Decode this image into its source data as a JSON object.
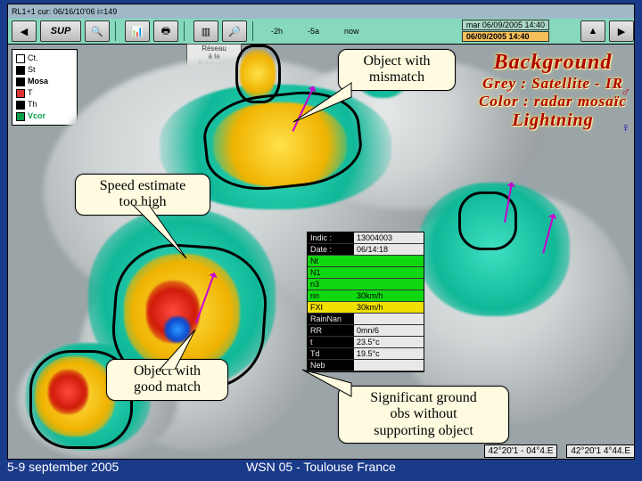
{
  "window_title": "RL1+1 cur: 06/16/10'06  i=149",
  "toolbar": {
    "sup_label": "SUP",
    "ticks": [
      "-2h",
      "-5a",
      "now"
    ],
    "date_valid": "mar 06/09/2005 14:40",
    "date_hilite": "06/09/2005 14:40"
  },
  "reseau": {
    "line1": "Réseau",
    "line2": "à la",
    "line3": "Echéance"
  },
  "left_legend": {
    "items": [
      {
        "label": "Ct.",
        "bold": false
      },
      {
        "label": "St",
        "bold": false
      },
      {
        "label": "Mosa",
        "bold": true
      },
      {
        "label": "T",
        "bold": false
      },
      {
        "label": "Th",
        "bold": false
      },
      {
        "label": "Vcor",
        "bold": true,
        "color": "#0aa04a"
      }
    ]
  },
  "bgtitle": {
    "l1": "Background",
    "l2": "Grey : Satellite - IR",
    "l3": "Color : radar mosaïc",
    "l4": "Lightning"
  },
  "callouts": {
    "mismatch": "Object with\nmismatch",
    "speed": "Speed estimate\ntoo high",
    "good": "Object with\ngood match",
    "ground": "Significant ground\nobs without\nsupporting object"
  },
  "infopanel": {
    "rows": [
      {
        "lab": "Indic :",
        "val": "13004003",
        "labcls": "",
        "valcls": ""
      },
      {
        "lab": "Date :",
        "val": "06/14:18",
        "labcls": "",
        "valcls": ""
      },
      {
        "lab": "Nt",
        "val": "",
        "labcls": "grn",
        "valcls": "grn"
      },
      {
        "lab": "N1",
        "val": "",
        "labcls": "grn",
        "valcls": "grn"
      },
      {
        "lab": "n3",
        "val": "",
        "labcls": "grn",
        "valcls": "grn"
      },
      {
        "lab": "nn",
        "val": "30km/h",
        "labcls": "grn",
        "valcls": "grn"
      },
      {
        "lab": "FXI",
        "val": "30km/h",
        "labcls": "yel2",
        "valcls": "yel2"
      },
      {
        "lab": "RainNan",
        "val": "",
        "labcls": "",
        "valcls": ""
      },
      {
        "lab": "RR",
        "val": "0mn/6",
        "labcls": "",
        "valcls": ""
      },
      {
        "lab": "t",
        "val": "23.5°c",
        "labcls": "",
        "valcls": ""
      },
      {
        "lab": "Td",
        "val": "19.5°c",
        "labcls": "",
        "valcls": ""
      },
      {
        "lab": "Neb",
        "val": "",
        "labcls": "",
        "valcls": ""
      }
    ]
  },
  "footer": {
    "left": "5-9 september 2005",
    "mid": "WSN 05 - Toulouse France"
  },
  "scale": {
    "a": "42°20'1 - 04°4.E",
    "b": "42°20'1 4°44.E"
  }
}
